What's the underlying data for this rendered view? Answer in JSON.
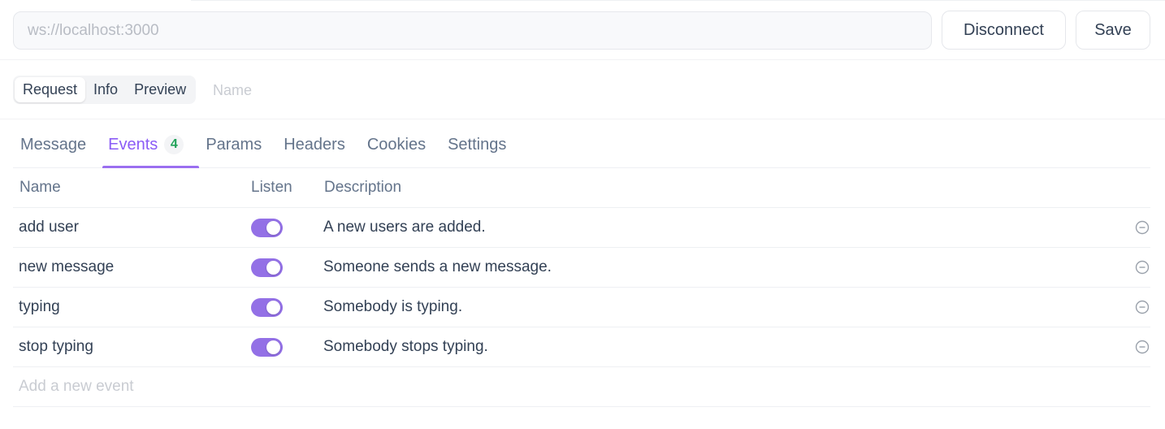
{
  "url_bar": {
    "value": "",
    "placeholder": "ws://localhost:3000"
  },
  "toolbar": {
    "disconnect_label": "Disconnect",
    "save_label": "Save"
  },
  "view_switch": {
    "items": [
      {
        "label": "Request",
        "active": true
      },
      {
        "label": "Info",
        "active": false
      },
      {
        "label": "Preview",
        "active": false
      }
    ],
    "name_placeholder": "Name"
  },
  "tabs": [
    {
      "label": "Message",
      "active": false
    },
    {
      "label": "Events",
      "active": true,
      "badge": "4"
    },
    {
      "label": "Params",
      "active": false
    },
    {
      "label": "Headers",
      "active": false
    },
    {
      "label": "Cookies",
      "active": false
    },
    {
      "label": "Settings",
      "active": false
    }
  ],
  "events_table": {
    "headers": {
      "name": "Name",
      "listen": "Listen",
      "description": "Description"
    },
    "rows": [
      {
        "name": "add user",
        "listen": true,
        "description": "A new users are added."
      },
      {
        "name": "new message",
        "listen": true,
        "description": "Someone sends a new message."
      },
      {
        "name": "typing",
        "listen": true,
        "description": "Somebody is typing."
      },
      {
        "name": "stop typing",
        "listen": true,
        "description": "Somebody stops typing."
      }
    ],
    "add_placeholder": "Add a new event"
  },
  "colors": {
    "accent": "#8b5cf6",
    "toggle_on": "#9370e6",
    "badge_text": "#22a35a"
  }
}
